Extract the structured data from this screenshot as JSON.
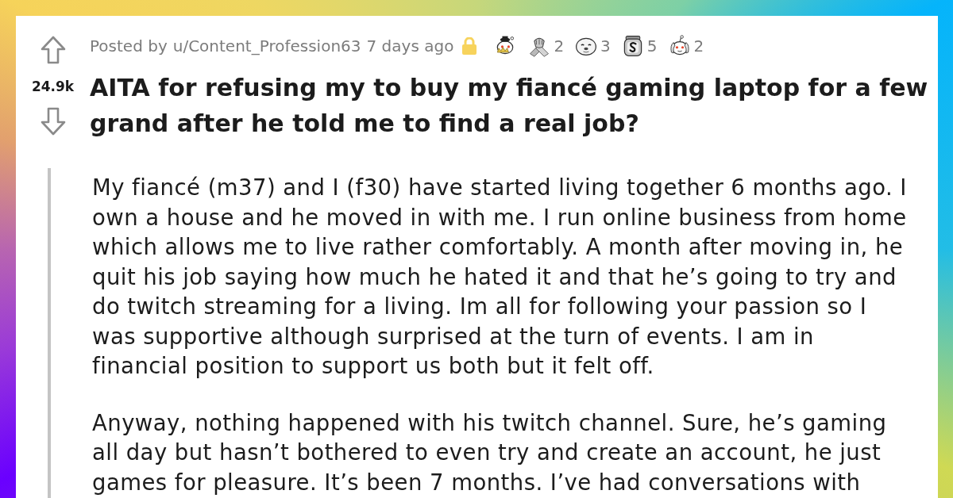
{
  "post": {
    "vote": {
      "score": "24.9k"
    },
    "meta": {
      "prefix": "Posted by",
      "author": "u/Content_Profession63",
      "age": "7 days ago",
      "locked": true
    },
    "awards": [
      {
        "kind": "crowned-mascot"
      },
      {
        "kind": "arm-wrestle",
        "count": "2"
      },
      {
        "kind": "seal",
        "count": "3"
      },
      {
        "kind": "coin-jar",
        "count": "5"
      },
      {
        "kind": "facepalm-mascot",
        "count": "2"
      }
    ],
    "title": "AITA for refusing my to buy my fiancé gaming laptop for a few grand after he told me to find a real job?",
    "body": [
      "My fiancé (m37) and I (f30) have started living together 6 months ago. I own a house and he moved in with me. I run online business from home which allows me to live rather comfortably. A month after moving in, he quit his job saying how much he hated it and that he’s going to try and do twitch streaming for a living. Im all for following your passion so I was supportive although surprised at the turn of events. I am in financial position to support us both but it felt off.",
      "Anyway, nothing happened with his twitch channel. Sure, he’s gaming all day but hasn’t bothered to even try and create an account, he just games for pleasure. It’s been 7 months. I’ve had conversations with"
    ]
  }
}
